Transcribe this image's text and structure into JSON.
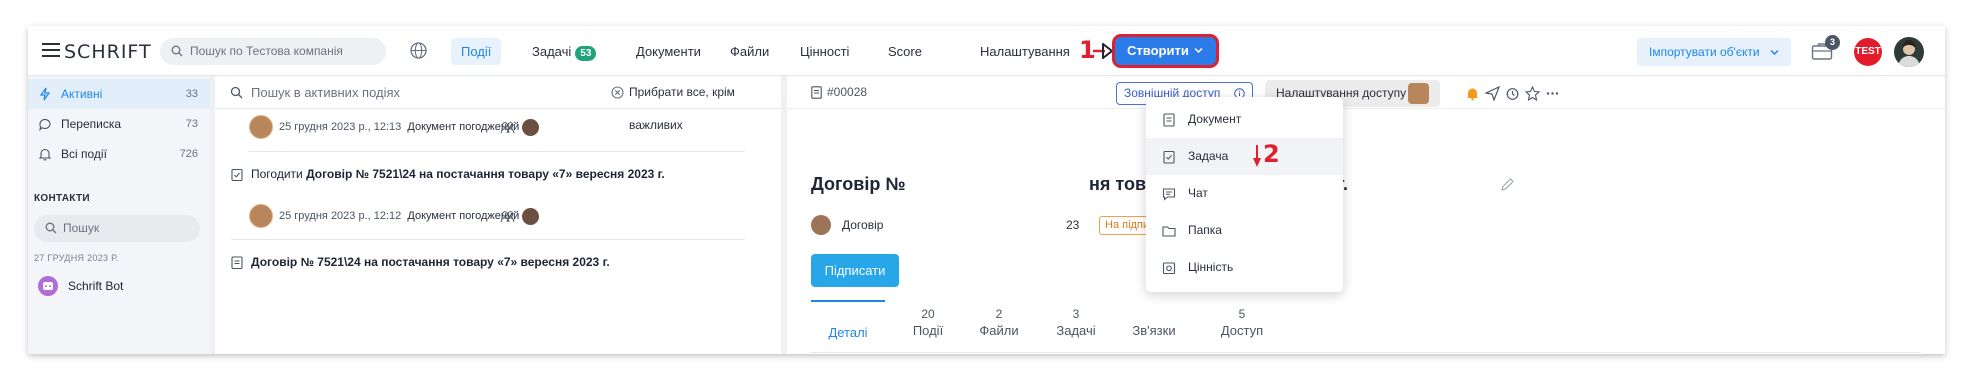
{
  "app": {
    "logo": "SCHRIFT",
    "search_placeholder": "Пошук по Тестова компанія"
  },
  "nav": {
    "events": "Події",
    "tasks": "Задачі",
    "tasks_count": "53",
    "documents": "Документи",
    "files": "Файли",
    "values": "Цінності",
    "score": "Score",
    "settings": "Налаштування",
    "create": "Створити",
    "import": "Імпортувати об'єкти",
    "briefcase_badge": "3",
    "test_avatar": "TEST"
  },
  "steps": {
    "one": "1",
    "two": "2"
  },
  "create_menu": {
    "items": [
      {
        "label": "Документ",
        "icon": "document-icon"
      },
      {
        "label": "Задача",
        "icon": "task-icon"
      },
      {
        "label": "Чат",
        "icon": "chat-icon"
      },
      {
        "label": "Папка",
        "icon": "folder-icon"
      },
      {
        "label": "Цінність",
        "icon": "value-icon"
      }
    ]
  },
  "sidebar": {
    "items": [
      {
        "label": "Активні",
        "count": "33"
      },
      {
        "label": "Переписка",
        "count": "73"
      },
      {
        "label": "Всі події",
        "count": "726"
      }
    ],
    "contacts_title": "КОНТАКТИ",
    "search_placeholder": "Пошук",
    "date_group": "27 ГРУДНЯ 2023 Р.",
    "bot_name": "Schrift Bot"
  },
  "events": {
    "search_placeholder": "Пошук в активних подіях",
    "clear_label": "Прибрати все, крім важливих",
    "entries": [
      {
        "date": "25 грудня 2023 р., 12:13",
        "type": "Документ погоджений"
      },
      {
        "title_prefix": "Погодити ",
        "title": "Договір № 7521\\24 на постачання товару «7» вересня 2023 г."
      },
      {
        "date": "25 грудня 2023 р., 12:12",
        "type": "Документ погоджений"
      },
      {
        "title": "Договір № 7521\\24 на постачання товару «7» вересня 2023 г."
      }
    ]
  },
  "document": {
    "id": "#00028",
    "external_access": "Зовнішній доступ",
    "access_settings": "Налаштування доступу",
    "title_start": "Договір №",
    "title_end": "ня товару «17» грудня 2023 г.",
    "author": "Договір",
    "year_fragment": "23",
    "status": "На підписанні",
    "sign_button": "Підписати",
    "tabs": [
      {
        "count": "",
        "label": "Деталі"
      },
      {
        "count": "20",
        "label": "Події"
      },
      {
        "count": "2",
        "label": "Файли"
      },
      {
        "count": "3",
        "label": "Задачі"
      },
      {
        "count": "",
        "label": "Зв'язки"
      },
      {
        "count": "5",
        "label": "Доступ"
      }
    ]
  },
  "colors": {
    "accent": "#1f86e8",
    "create_button": "#2b7ce9",
    "highlight_red": "#e0202f",
    "status_orange": "#e07a18"
  }
}
